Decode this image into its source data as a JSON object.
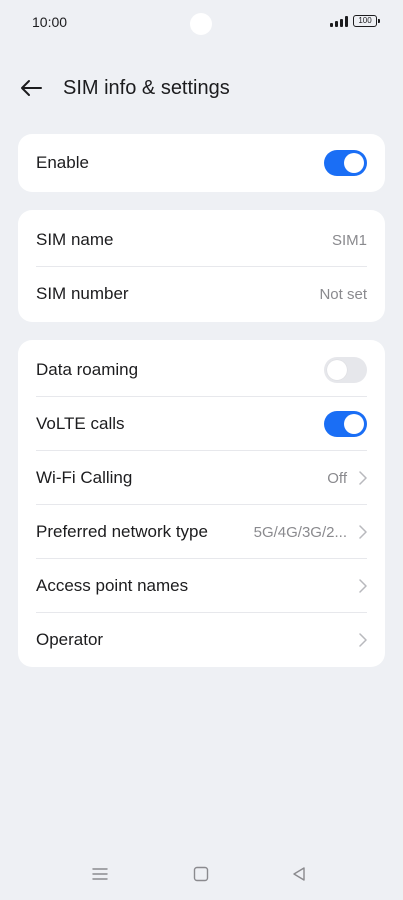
{
  "status_bar": {
    "time": "10:00",
    "battery": "100"
  },
  "header": {
    "title": "SIM info & settings"
  },
  "card_enable": {
    "label": "Enable",
    "enabled": true
  },
  "card_sim": {
    "items": [
      {
        "label": "SIM name",
        "value": "SIM1"
      },
      {
        "label": "SIM number",
        "value": "Not set"
      }
    ]
  },
  "card_network": {
    "data_roaming": {
      "label": "Data roaming",
      "enabled": false
    },
    "volte": {
      "label": "VoLTE calls",
      "enabled": true
    },
    "wifi_calling": {
      "label": "Wi-Fi Calling",
      "value": "Off"
    },
    "preferred_network": {
      "label": "Preferred network type",
      "value": "5G/4G/3G/2..."
    },
    "apn": {
      "label": "Access point names"
    },
    "operator": {
      "label": "Operator"
    }
  },
  "colors": {
    "accent": "#1a6ef5",
    "background": "#eef0f4",
    "card": "#ffffff"
  },
  "icons": [
    "back-arrow-icon",
    "chevron-right-icon",
    "menu-icon",
    "home-icon",
    "back-triangle-icon"
  ]
}
